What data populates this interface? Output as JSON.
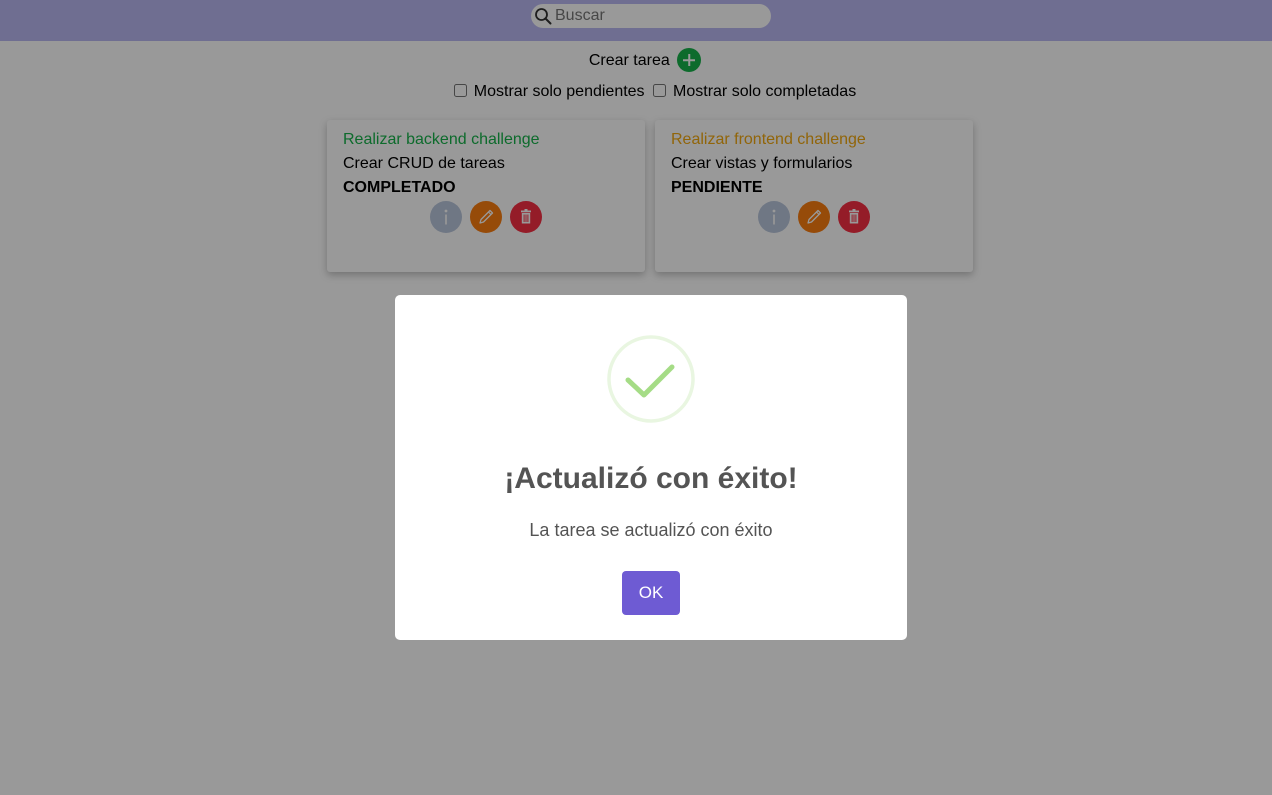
{
  "search": {
    "placeholder": "Buscar"
  },
  "toolbar": {
    "create_label": "Crear tarea"
  },
  "filters": {
    "pending_label": "Mostrar solo pendientes",
    "completed_label": "Mostrar solo completadas"
  },
  "tasks": [
    {
      "title": "Realizar backend challenge",
      "description": "Crear CRUD de tareas",
      "status": "COMPLETADO",
      "title_color": "#16b24a"
    },
    {
      "title": "Realizar frontend challenge",
      "description": "Crear vistas y formularios",
      "status": "PENDIENTE",
      "title_color": "#f2a80f"
    }
  ],
  "modal": {
    "title": "¡Actualizó con éxito!",
    "text": "La tarea se actualizó con éxito",
    "ok_label": "OK"
  },
  "icons": {
    "search": "search-icon",
    "add": "plus-icon",
    "info": "info-icon",
    "edit": "pencil-icon",
    "delete": "trash-icon",
    "success": "checkmark-icon"
  },
  "colors": {
    "header": "#b9b7f2",
    "completed": "#16b24a",
    "pending": "#f2a80f",
    "confirm": "#6e5bd3"
  }
}
